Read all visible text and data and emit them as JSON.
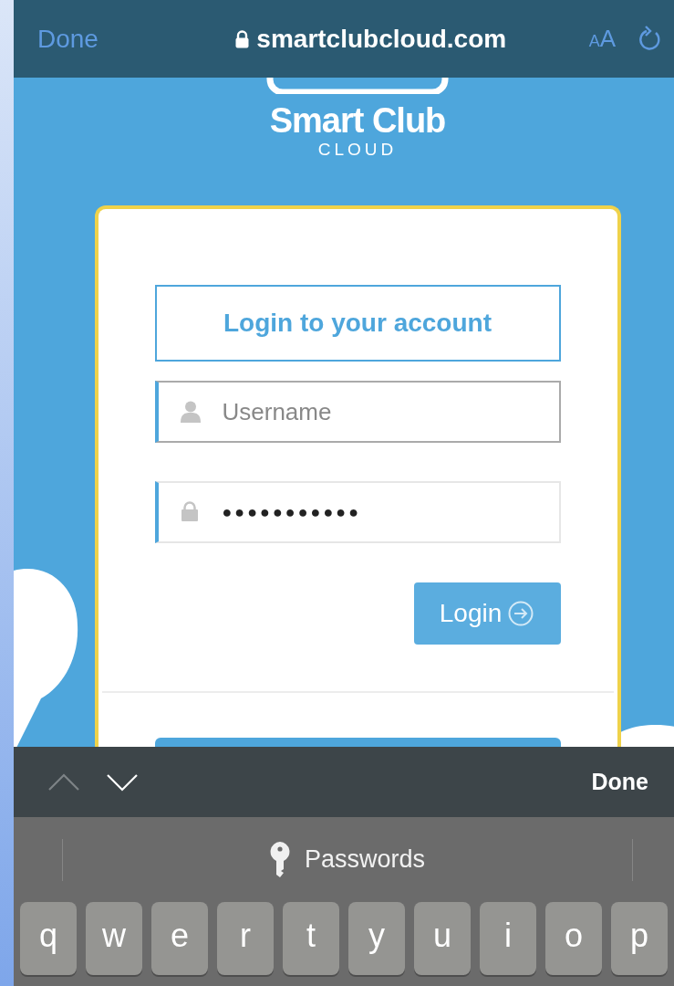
{
  "browser_bar": {
    "done": "Done",
    "lock": true,
    "url": "smartclubcloud.com",
    "text_size": "AA"
  },
  "logo": {
    "name": "Smart Club",
    "sub": "CLOUD"
  },
  "login_card": {
    "title": "Login to your account",
    "fields": [
      {
        "kind": "username",
        "placeholder": "Username",
        "focused": false
      },
      {
        "kind": "password",
        "value": "●●●●●●●●●●●",
        "focused": true
      }
    ],
    "button": "Login"
  },
  "keyboard_toolbar": {
    "previous_enabled": false,
    "next_enabled": true,
    "done": "Done"
  },
  "autofill": {
    "label": "Passwords"
  },
  "keys": [
    "q",
    "w",
    "e",
    "r",
    "t",
    "y",
    "u",
    "i",
    "o",
    "p"
  ]
}
